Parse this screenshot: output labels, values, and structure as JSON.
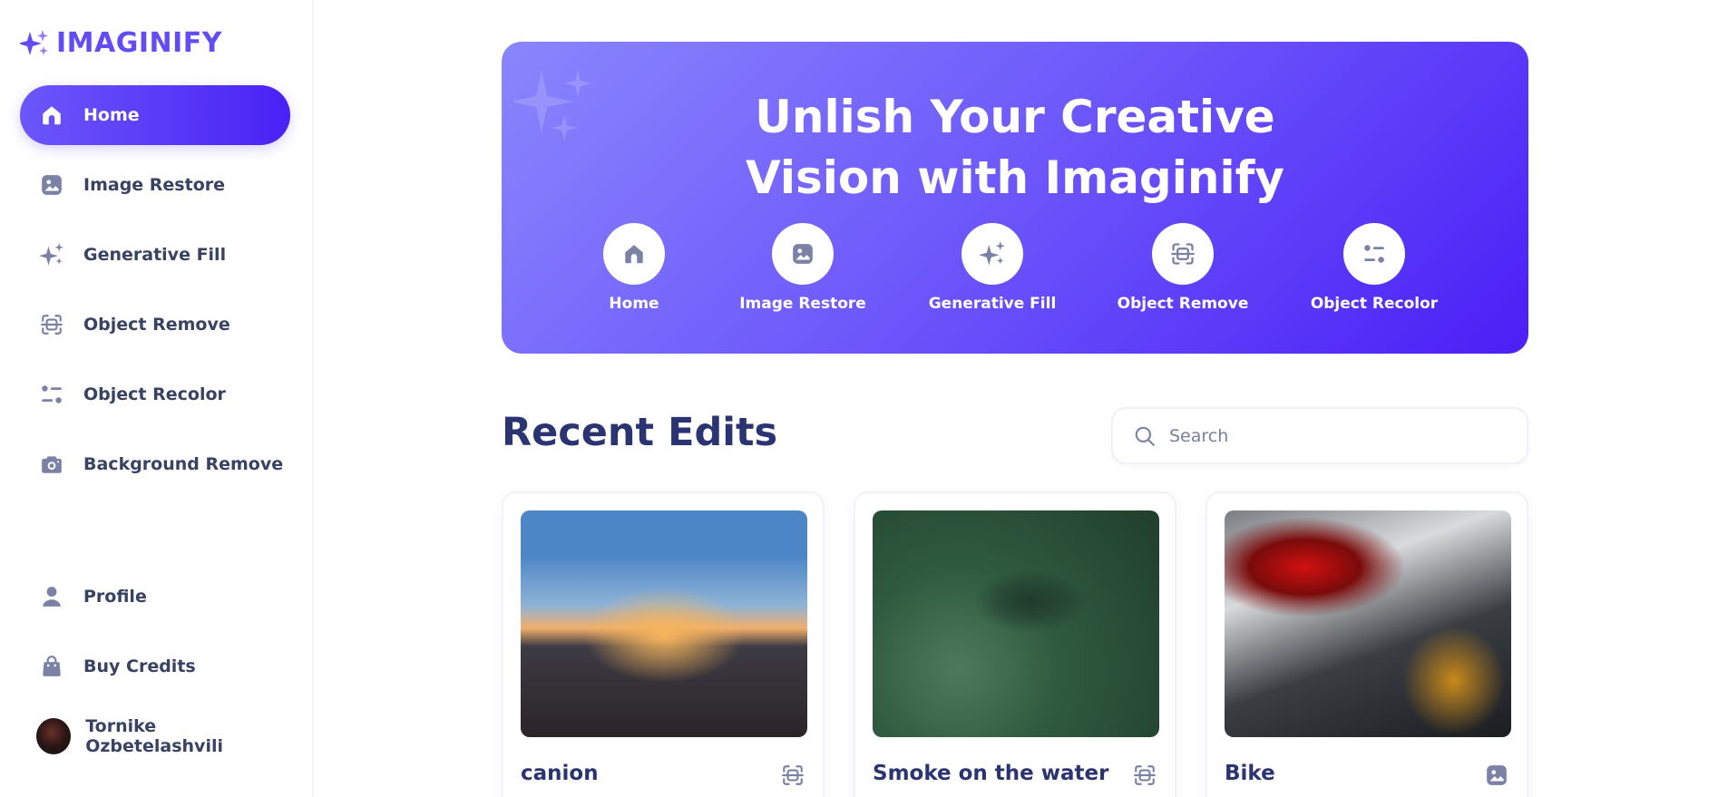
{
  "app": {
    "name": "IMAGINIFY",
    "brand_color": "#624cf5"
  },
  "sidebar": {
    "items": [
      {
        "label": "Home",
        "icon": "home-icon",
        "active": true
      },
      {
        "label": "Image Restore",
        "icon": "image-icon",
        "active": false
      },
      {
        "label": "Generative Fill",
        "icon": "sparkles-icon",
        "active": false
      },
      {
        "label": "Object Remove",
        "icon": "scan-icon",
        "active": false
      },
      {
        "label": "Object Recolor",
        "icon": "filter-icon",
        "active": false
      },
      {
        "label": "Background Remove",
        "icon": "camera-icon",
        "active": false
      }
    ],
    "bottom_items": [
      {
        "label": "Profile",
        "icon": "user-icon"
      },
      {
        "label": "Buy Credits",
        "icon": "bag-icon"
      }
    ],
    "user": {
      "name": "Tornike Ozbetelashvili"
    }
  },
  "banner": {
    "title_line1": "Unlish Your Creative",
    "title_line2": "Vision with Imaginify",
    "links": [
      {
        "label": "Home",
        "icon": "home-icon"
      },
      {
        "label": "Image Restore",
        "icon": "image-icon"
      },
      {
        "label": "Generative Fill",
        "icon": "sparkles-icon"
      },
      {
        "label": "Object Remove",
        "icon": "scan-icon"
      },
      {
        "label": "Object Recolor",
        "icon": "filter-icon"
      }
    ]
  },
  "recent": {
    "title": "Recent Edits",
    "search_placeholder": "Search",
    "cards": [
      {
        "title": "canion",
        "icon": "scan-icon"
      },
      {
        "title": "Smoke on the water",
        "icon": "scan-icon"
      },
      {
        "title": "Bike",
        "icon": "image-icon"
      }
    ]
  }
}
